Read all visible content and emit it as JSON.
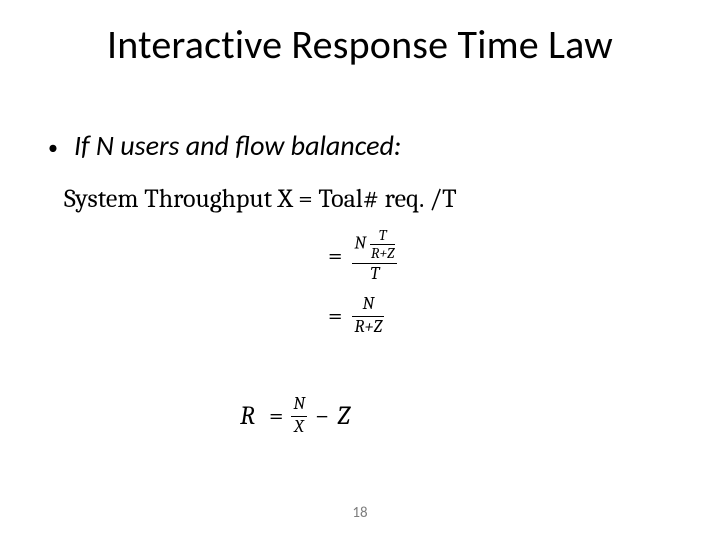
{
  "title": "Interactive Response Time Law",
  "bullet": {
    "marker": "•",
    "text": "If N users and flow balanced:"
  },
  "eq1": "System Throughput X = Toal# req. /T",
  "eq2": {
    "eq": "=",
    "num_factor": "N",
    "inner_num": "T",
    "inner_den": "R+Z",
    "den": "T"
  },
  "eq3": {
    "eq": "=",
    "num": "N",
    "den": "R+Z"
  },
  "eq4": {
    "R": "R",
    "eq": "=",
    "num": "N",
    "den": "X",
    "minus": "−",
    "Z": "Z"
  },
  "page_number": "18"
}
